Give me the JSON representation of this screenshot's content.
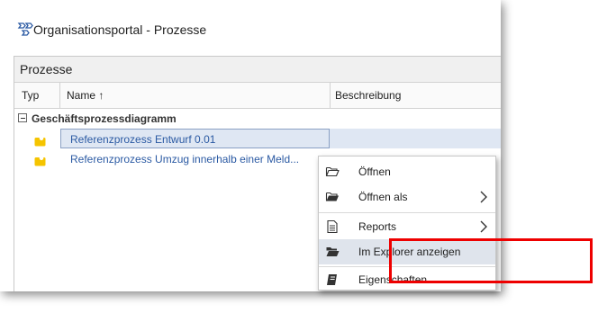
{
  "window": {
    "title": "Organisationsportal - Prozesse"
  },
  "panel": {
    "title": "Prozesse",
    "columns": {
      "typ": "Typ",
      "name": "Name ↑",
      "beschreibung": "Beschreibung"
    },
    "group": {
      "label": "Geschäftsprozessdiagramm",
      "expanded": true
    },
    "rows": [
      {
        "name": "Referenzprozess Entwurf 0.01",
        "selected": true
      },
      {
        "name": "Referenzprozess Umzug innerhalb einer Meld...",
        "selected": false
      }
    ]
  },
  "context_menu": {
    "items": [
      {
        "label": "Öffnen",
        "icon": "folder-open-icon",
        "submenu": false
      },
      {
        "label": "Öffnen als",
        "icon": "folder-open-icon",
        "submenu": true
      },
      {
        "label": "Reports",
        "icon": "document-icon",
        "submenu": true
      },
      {
        "label": "Im Explorer anzeigen",
        "icon": "folder-filled-icon",
        "submenu": false,
        "highlighted": true
      },
      {
        "label": "Eigenschaften",
        "icon": "book-icon",
        "submenu": false
      }
    ]
  },
  "colors": {
    "accent_text": "#2b5aa3",
    "selection": "#dfe7f3",
    "annotation_red": "#ee0000",
    "process_icon": "#f5c400"
  }
}
